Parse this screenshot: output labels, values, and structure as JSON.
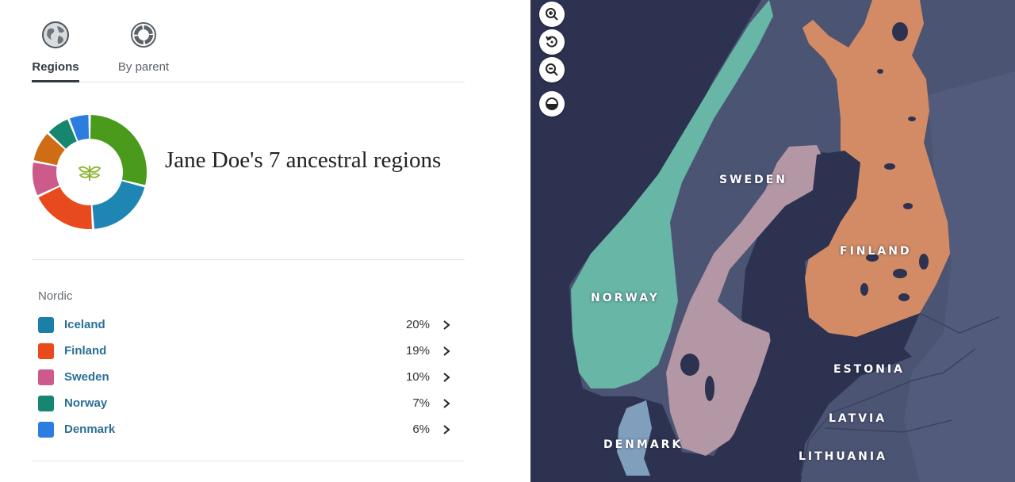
{
  "tabs": [
    {
      "label": "Regions",
      "icon": "globe-icon",
      "active": true
    },
    {
      "label": "By parent",
      "icon": "ring-icon",
      "active": false
    }
  ],
  "summary": {
    "title": "Jane Doe's 7 ancestral regions",
    "center_icon": "sprout-icon"
  },
  "group": {
    "label": "Nordic"
  },
  "regions": [
    {
      "name": "Iceland",
      "percent": "20%",
      "color": "#1b7fa8"
    },
    {
      "name": "Finland",
      "percent": "19%",
      "color": "#e8491d"
    },
    {
      "name": "Sweden",
      "percent": "10%",
      "color": "#cc5a8a"
    },
    {
      "name": "Norway",
      "percent": "7%",
      "color": "#17866f"
    },
    {
      "name": "Denmark",
      "percent": "6%",
      "color": "#2b7de0"
    }
  ],
  "donut": {
    "segments": [
      {
        "color": "#4a9a1c",
        "value": 29
      },
      {
        "color": "#1f86b4",
        "value": 20
      },
      {
        "color": "#e8491d",
        "value": 19
      },
      {
        "color": "#cc5a8a",
        "value": 10
      },
      {
        "color": "#cf6d14",
        "value": 9
      },
      {
        "color": "#17866f",
        "value": 7
      },
      {
        "color": "#2b7de0",
        "value": 6
      }
    ]
  },
  "map": {
    "labels": {
      "sweden": "SWEDEN",
      "finland": "FINLAND",
      "norway": "NORWAY",
      "estonia": "ESTONIA",
      "latvia": "LATVIA",
      "denmark": "DENMARK",
      "lithuania": "LITHUANIA"
    },
    "controls": [
      "zoom-in-icon",
      "reset-icon",
      "zoom-out-icon",
      "contrast-icon"
    ]
  }
}
